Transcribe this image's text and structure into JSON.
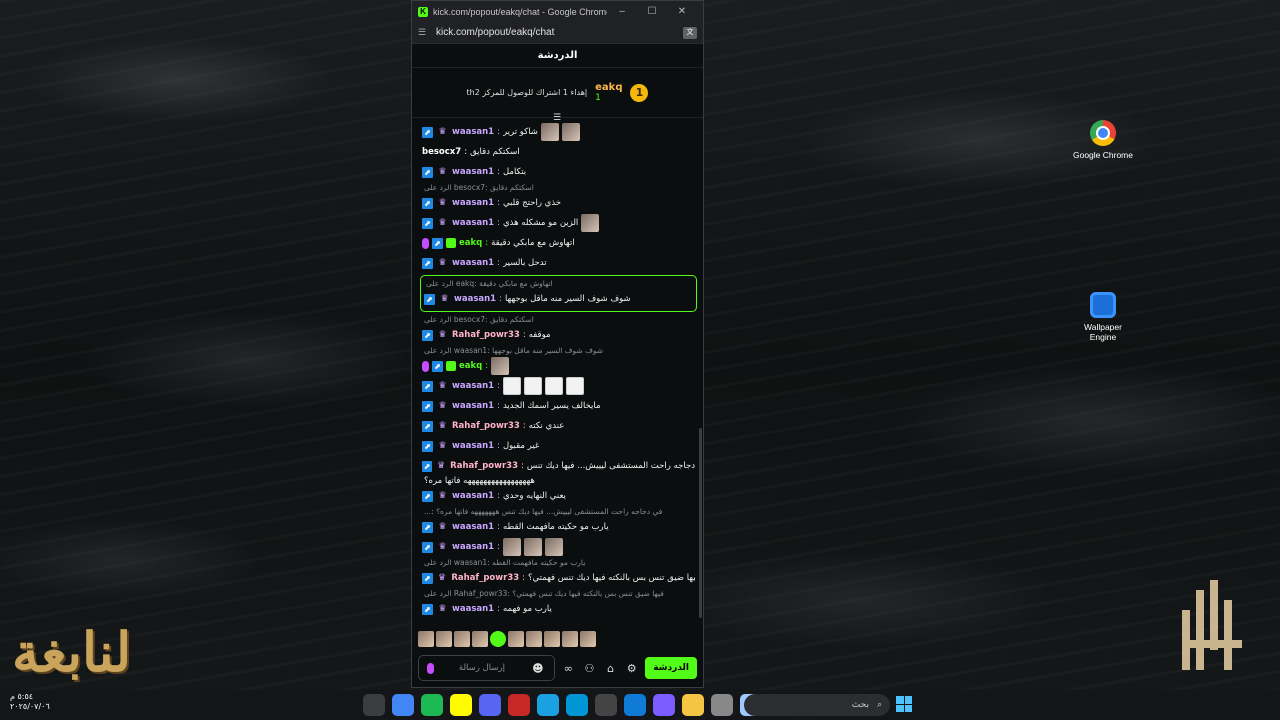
{
  "window": {
    "title": "kick.com/popout/eakq/chat - Google Chrome",
    "url": "kick.com/popout/eakq/chat",
    "controls": [
      "–",
      "☐",
      "✕"
    ]
  },
  "chat": {
    "header": "الدردشة",
    "goal": {
      "count": "1",
      "username": "eakq",
      "subs": "1",
      "description": "thإهداء 1 اشتراك للوصول للمركز 2"
    },
    "messages": [
      {
        "badges": [
          "vip",
          "crown"
        ],
        "user": "waasan1",
        "color": "#c9a7ff",
        "text": "شاكو ترير",
        "emotes": 2
      },
      {
        "badges": [],
        "user": "besocx7",
        "color": "#ffffff",
        "text": "اسكتكم دقايق"
      },
      {
        "badges": [
          "vip",
          "crown"
        ],
        "user": "waasan1",
        "color": "#c9a7ff",
        "text": "بتكامل"
      },
      {
        "badges": [
          "vip",
          "crown"
        ],
        "user": "waasan1",
        "color": "#c9a7ff",
        "text": "خذي راحتج قلبي",
        "reply": "الرد على besocx7: اسكتكم دقايق"
      },
      {
        "badges": [
          "vip",
          "crown"
        ],
        "user": "waasan1",
        "color": "#c9a7ff",
        "text": "الزين مو مشكله هذي",
        "emotes": 1
      },
      {
        "badges": [
          "mic",
          "vip",
          "sub"
        ],
        "user": "eakq",
        "color": "#53fc18",
        "text": "اتهاوش مع مابكي دقيقة"
      },
      {
        "badges": [
          "vip",
          "crown"
        ],
        "user": "waasan1",
        "color": "#c9a7ff",
        "text": "تدحل بالسير"
      },
      {
        "badges": [
          "vip",
          "crown"
        ],
        "user": "waasan1",
        "color": "#c9a7ff",
        "text": "شوف شوف السير منه ماقل بوجهها",
        "reply": "الرد على eakq: اتهاوش مع مابكي دقيقة",
        "highlight": true
      },
      {
        "badges": [
          "vip",
          "crown"
        ],
        "user": "Rahaf_powr33",
        "color": "#ffb3c8",
        "text": "موقفه",
        "reply": "الرد على besocx7: اسكتكم دقايق"
      },
      {
        "badges": [
          "mic",
          "vip",
          "sub"
        ],
        "user": "eakq",
        "color": "#53fc18",
        "text": "",
        "emotes": 1,
        "reply": "الرد على waasan1: شوف شوف السير منه ماقل بوجهها"
      },
      {
        "badges": [
          "vip",
          "crown"
        ],
        "user": "waasan1",
        "color": "#c9a7ff",
        "text": "",
        "emotes": 4,
        "whiteEmotes": true
      },
      {
        "badges": [
          "vip",
          "crown"
        ],
        "user": "waasan1",
        "color": "#c9a7ff",
        "text": "مايخالف يسير اسمك الجديد"
      },
      {
        "badges": [
          "vip",
          "crown"
        ],
        "user": "Rahaf_powr33",
        "color": "#ffb3c8",
        "text": "عندي نكته"
      },
      {
        "badges": [
          "vip",
          "crown"
        ],
        "user": "waasan1",
        "color": "#c9a7ff",
        "text": "غير مقبول"
      },
      {
        "badges": [
          "vip",
          "crown"
        ],
        "user": "Rahaf_powr33",
        "color": "#ffb3c8",
        "text": "في دجاجه راحت المستشفى ليييش... فيها ديك تنس",
        "text2": "هههههههههههههههههه فاتها مره؟"
      },
      {
        "badges": [
          "vip",
          "crown"
        ],
        "user": "waasan1",
        "color": "#c9a7ff",
        "text": "يعني النهايه وحدي"
      },
      {
        "badges": [
          "vip",
          "crown"
        ],
        "user": "waasan1",
        "color": "#c9a7ff",
        "text": "يارب مو حكيته مافهمت القطه",
        "reply": "...: في دجاجه راحت المستشفى ليييش... فيها ديك تنس هههههههه فاتها مره؟"
      },
      {
        "badges": [
          "vip",
          "crown"
        ],
        "user": "waasan1",
        "color": "#c9a7ff",
        "text": "",
        "emotes": 3
      },
      {
        "badges": [
          "vip",
          "crown"
        ],
        "user": "Rahaf_powr33",
        "color": "#ffb3c8",
        "text": "فيها ضيق تنس بس بالنكته فيها ديك تنس فهمتي؟",
        "reply": "الرد على waasan1: يارب مو حكيته مافهمت القطه"
      },
      {
        "badges": [
          "vip",
          "crown"
        ],
        "user": "waasan1",
        "color": "#c9a7ff",
        "text": "يارب مو فهمه",
        "reply": "الرد على Rahaf_powr33: فيها ضيق تنس بس بالنكته فيها ديك تنس فهمتي؟"
      }
    ],
    "composer": {
      "placeholder": "إرسال رسالة",
      "send_label": "الدردشة"
    }
  },
  "desktop": {
    "icons": [
      {
        "label": "Google Chrome",
        "glyph": "chrome-icon"
      },
      {
        "label": "Wallpaper Engine",
        "glyph": "wallpaper-engine-icon"
      }
    ]
  },
  "taskbar": {
    "time": "٥:٥٤ م",
    "date": "٢٠٢٥/٠٧/٠٦",
    "search_placeholder": "بحث",
    "apps": [
      "steam",
      "chrome",
      "spotify",
      "snapchat",
      "discord",
      "game",
      "edge-alt",
      "hp",
      "store",
      "edge",
      "copilot",
      "folder",
      "window",
      "cloud"
    ]
  }
}
